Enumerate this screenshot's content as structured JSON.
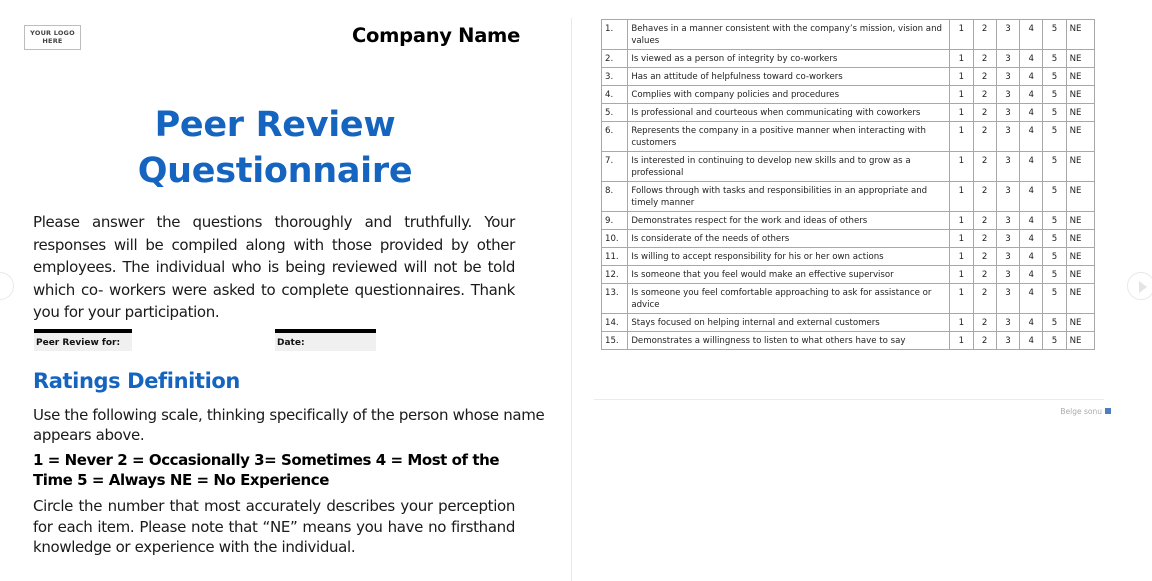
{
  "header": {
    "logo_line1": "YOUR LOGO",
    "logo_line2": "HERE",
    "company_name": "Company Name"
  },
  "title": {
    "line1": "Peer Review",
    "line2": "Questionnaire"
  },
  "intro": "Please answer the questions thoroughly and truthfully. Your responses will be compiled along with those provided by other employees. The individual who is being reviewed will not be told which co- workers were asked to complete questionnaires. Thank you for your participation.",
  "fields": {
    "peer_review_for": "Peer Review for:",
    "date": "Date:"
  },
  "ratings": {
    "heading": "Ratings Definition",
    "instruction": "Use the following scale, thinking specifically of the person whose name appears above.",
    "scale": "1 = Never   2 = Occasionally  3= Sometimes 4 = Most of the Time 5 = Always NE = No Experience",
    "circle_note": "Circle the number that most accurately describes your perception for each item. Please note that “NE” means you have no firsthand knowledge or experience with the individual."
  },
  "table": {
    "scores": [
      "1",
      "2",
      "3",
      "4",
      "5",
      "NE"
    ],
    "rows": [
      {
        "num": "1.",
        "text": "Behaves in a manner consistent with the company’s mission, vision and values"
      },
      {
        "num": "2.",
        "text": "Is viewed as a person of integrity by co-workers"
      },
      {
        "num": "3.",
        "text": "Has an attitude of helpfulness toward co-workers"
      },
      {
        "num": "4.",
        "text": "Complies with company policies and procedures"
      },
      {
        "num": "5.",
        "text": "Is professional and courteous when communicating with coworkers"
      },
      {
        "num": "6.",
        "text": "Represents the company in a positive manner when interacting with customers"
      },
      {
        "num": "7.",
        "text": "Is interested in continuing to develop new skills and to grow as a professional"
      },
      {
        "num": "8.",
        "text": "Follows through with tasks and responsibilities in an appropriate and timely manner"
      },
      {
        "num": "9.",
        "text": "Demonstrates respect for the work and ideas of others"
      },
      {
        "num": "10.",
        "text": "Is considerate of the needs of others"
      },
      {
        "num": "11.",
        "text": "Is willing to accept responsibility for his or her own actions"
      },
      {
        "num": "12.",
        "text": "Is someone that you feel would make an effective supervisor"
      },
      {
        "num": "13.",
        "text": "Is someone you feel comfortable approaching to ask for assistance or advice"
      },
      {
        "num": "14.",
        "text": "Stays focused on helping internal and external customers"
      },
      {
        "num": "15.",
        "text": "Demonstrates a willingness to listen to what others have to say"
      }
    ]
  },
  "footer": {
    "end_of_document": "Belge sonu",
    "end_marker_color": "#4a7fc1"
  },
  "navigation": {
    "prev_icon": "chevron-left-circle-icon",
    "next_icon": "play-circle-icon"
  }
}
